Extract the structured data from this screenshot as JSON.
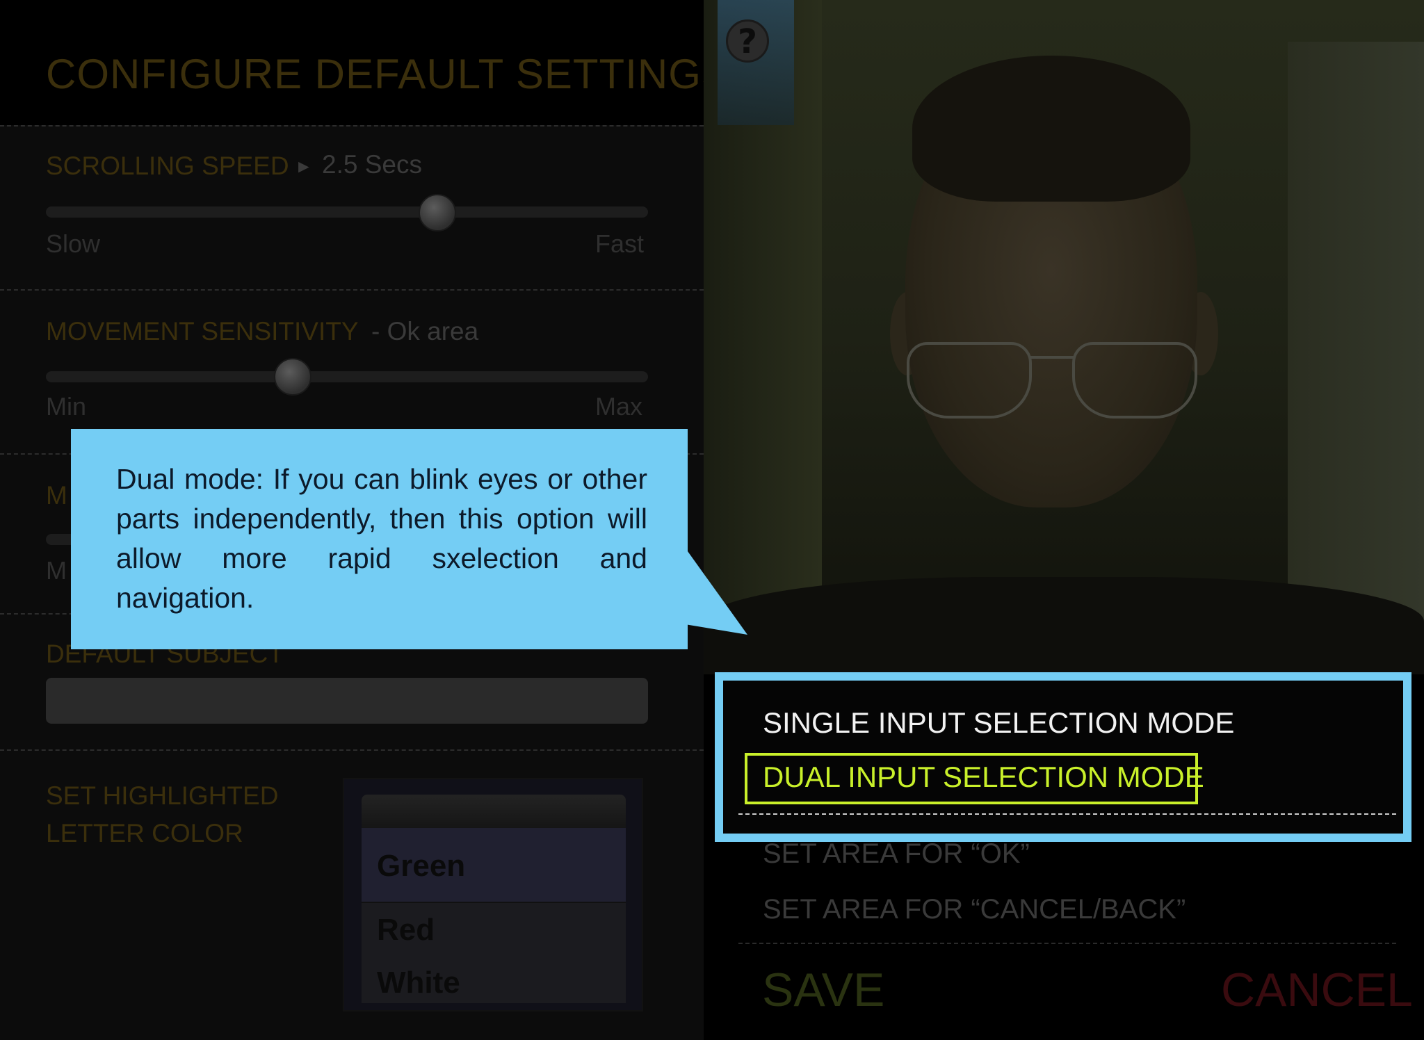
{
  "header": {
    "title": "CONFIGURE DEFAULT SETTINGS"
  },
  "scrolling_speed": {
    "label": "SCROLLING SPEED",
    "arrow": "►",
    "value": "2.5 Secs",
    "min_label": "Slow",
    "max_label": "Fast",
    "level": 0.65
  },
  "movement_sensitivity": {
    "label": "MOVEMENT SENSITIVITY",
    "value": "- Ok area",
    "min_label": "Min",
    "max_label": "Max",
    "level": 0.41
  },
  "hidden_section": {
    "label_fragment": "M",
    "min_fragment": "M"
  },
  "default_subject": {
    "label": "DEFAULT SUBJECT",
    "value": ""
  },
  "highlight_color": {
    "label_line1": "SET HIGHLIGHTED",
    "label_line2": "LETTER COLOR",
    "options": [
      "Green",
      "Red",
      "White"
    ],
    "selected": "Green"
  },
  "callout": {
    "text": "Dual mode:  If you can blink eyes or other parts independently, then this option will allow more rapid sxelection and navigation."
  },
  "help": {
    "icon": "question-icon",
    "glyph": "?"
  },
  "modes": {
    "single": "SINGLE INPUT SELECTION MODE",
    "dual": "DUAL INPUT SELECTION MODE"
  },
  "area_settings": {
    "ok": "SET AREA FOR “OK”",
    "cancel_back": "SET AREA FOR “CANCEL/BACK”"
  },
  "actions": {
    "save": "SAVE",
    "cancel": "CANCEL"
  },
  "colors": {
    "callout": "#74cdf4",
    "dual_highlight": "#c9f02a",
    "save": "#2a3311",
    "cancel": "#3a0b0f"
  }
}
